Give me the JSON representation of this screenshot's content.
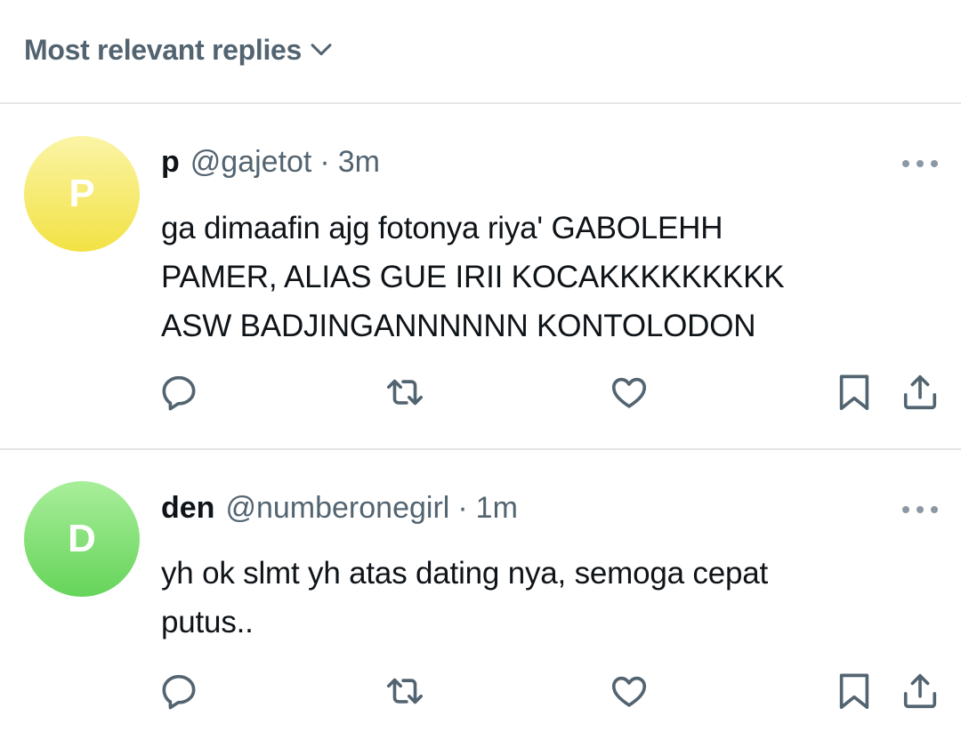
{
  "header": {
    "sort_label": "Most relevant replies",
    "sort_icon": "chevron-down-icon"
  },
  "colors": {
    "secondary_text": "#536471",
    "divider": "#e3e6e9",
    "icon": "#536471"
  },
  "replies": [
    {
      "avatar_letter": "P",
      "avatar_gradient": [
        "#fbf4a6",
        "#f2e244"
      ],
      "name": "p",
      "handle": "@gajetot",
      "separator": "·",
      "time": "3m",
      "text": "ga dimaafin ajg fotonya riya' GABOLEHH\nPAMER, ALIAS GUE IRII KOCAKKKKKKKKK\nASW BADJINGANNNNNN KONTOLODON",
      "actions": [
        "reply-icon",
        "retweet-icon",
        "like-icon",
        "bookmark-icon",
        "share-icon"
      ]
    },
    {
      "avatar_letter": "D",
      "avatar_gradient": [
        "#a8ee9a",
        "#66d45a"
      ],
      "name": "den",
      "handle": "@numberonegirl",
      "separator": "·",
      "time": "1m",
      "text": "yh ok slmt yh atas dating nya, semoga cepat\nputus..",
      "actions": [
        "reply-icon",
        "retweet-icon",
        "like-icon",
        "bookmark-icon",
        "share-icon"
      ]
    }
  ]
}
